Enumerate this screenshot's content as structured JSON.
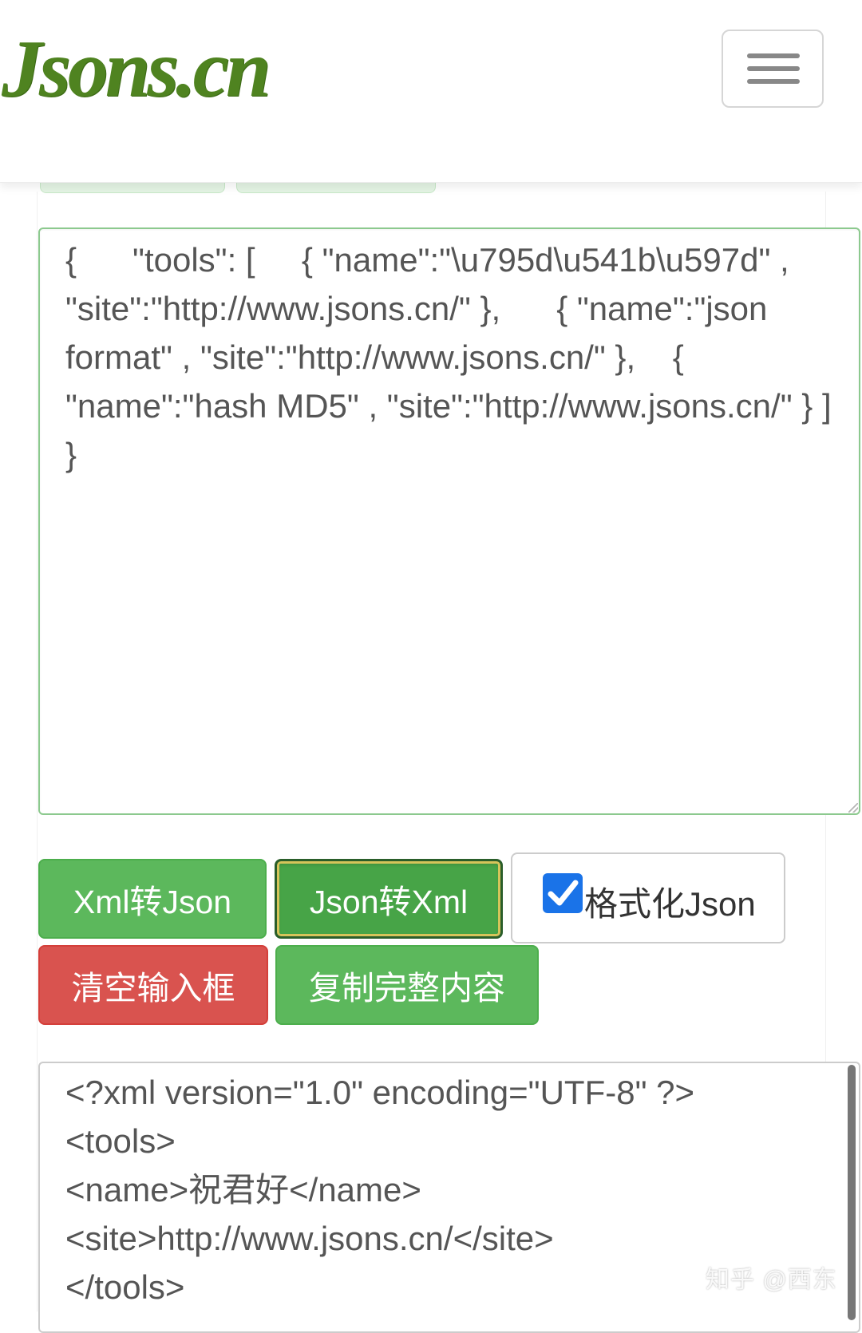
{
  "header": {
    "logo_text": "Jsons.cn",
    "menu_toggle_icon": "hamburger-menu-icon"
  },
  "json_input": {
    "value": "{      \"tools\": [     { \"name\":\"\\u795d\\u541b\\u597d\" , \"site\":\"http://www.jsons.cn/\" },      { \"name\":\"json format\" , \"site\":\"http://www.jsons.cn/\" },    { \"name\":\"hash MD5\" , \"site\":\"http://www.jsons.cn/\" } ]      }"
  },
  "buttons": {
    "xml_to_json": "Xml转Json",
    "json_to_xml": "Json转Xml",
    "clear_input": "清空输入框",
    "copy_content": "复制完整内容"
  },
  "format_option": {
    "label": "格式化Json",
    "checked": true,
    "checkbox_color": "#1a73e8"
  },
  "xml_output": {
    "value": "<?xml version=\"1.0\" encoding=\"UTF-8\" ?>\n<tools>\n<name>祝君好</name>\n<site>http://www.jsons.cn/</site>\n</tools>"
  },
  "watermark": "知乎 @西东",
  "colors": {
    "brand_green": "#4f8320",
    "success": "#5cb85c",
    "danger": "#d9534f",
    "input_focus_border": "#8cc98e"
  }
}
